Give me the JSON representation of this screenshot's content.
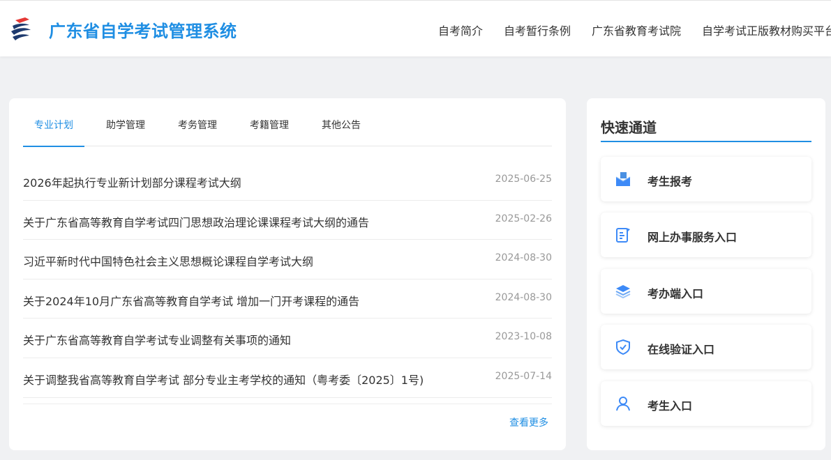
{
  "header": {
    "title": "广东省自学考试管理系统",
    "logo_icon": "gdzk-logo-icon",
    "nav": [
      {
        "label": "自考简介"
      },
      {
        "label": "自考暂行条例"
      },
      {
        "label": "广东省教育考试院"
      },
      {
        "label": "自学考试正版教材购买平台"
      }
    ]
  },
  "news": {
    "tabs": [
      {
        "label": "专业计划",
        "active": true
      },
      {
        "label": "助学管理",
        "active": false
      },
      {
        "label": "考务管理",
        "active": false
      },
      {
        "label": "考籍管理",
        "active": false
      },
      {
        "label": "其他公告",
        "active": false
      }
    ],
    "items": [
      {
        "title": "2026年起执行专业新计划部分课程考试大纲",
        "date": "2025-06-25"
      },
      {
        "title": "关于广东省高等教育自学考试四门思想政治理论课课程考试大纲的通告",
        "date": "2025-02-26"
      },
      {
        "title": "习近平新时代中国特色社会主义思想概论课程自学考试大纲",
        "date": "2024-08-30"
      },
      {
        "title": "关于2024年10月广东省高等教育自学考试 增加一门开考课程的通告",
        "date": "2024-08-30"
      },
      {
        "title": "关于广东省高等教育自学考试专业调整有关事项的通知",
        "date": "2023-10-08"
      },
      {
        "title": "关于调整我省高等教育自学考试 部分专业主考学校的通知（粤考委〔2025〕1号)",
        "date": "2025-07-14"
      }
    ],
    "more_label": "查看更多"
  },
  "quick": {
    "title": "快速通道",
    "accent": "#1f8ee3",
    "items": [
      {
        "label": "考生报考",
        "icon": "mailbox-icon"
      },
      {
        "label": "网上办事服务入口",
        "icon": "document-edit-icon"
      },
      {
        "label": "考办端入口",
        "icon": "layers-icon"
      },
      {
        "label": "在线验证入口",
        "icon": "shield-check-icon"
      },
      {
        "label": "考生入口",
        "icon": "user-icon"
      }
    ]
  }
}
